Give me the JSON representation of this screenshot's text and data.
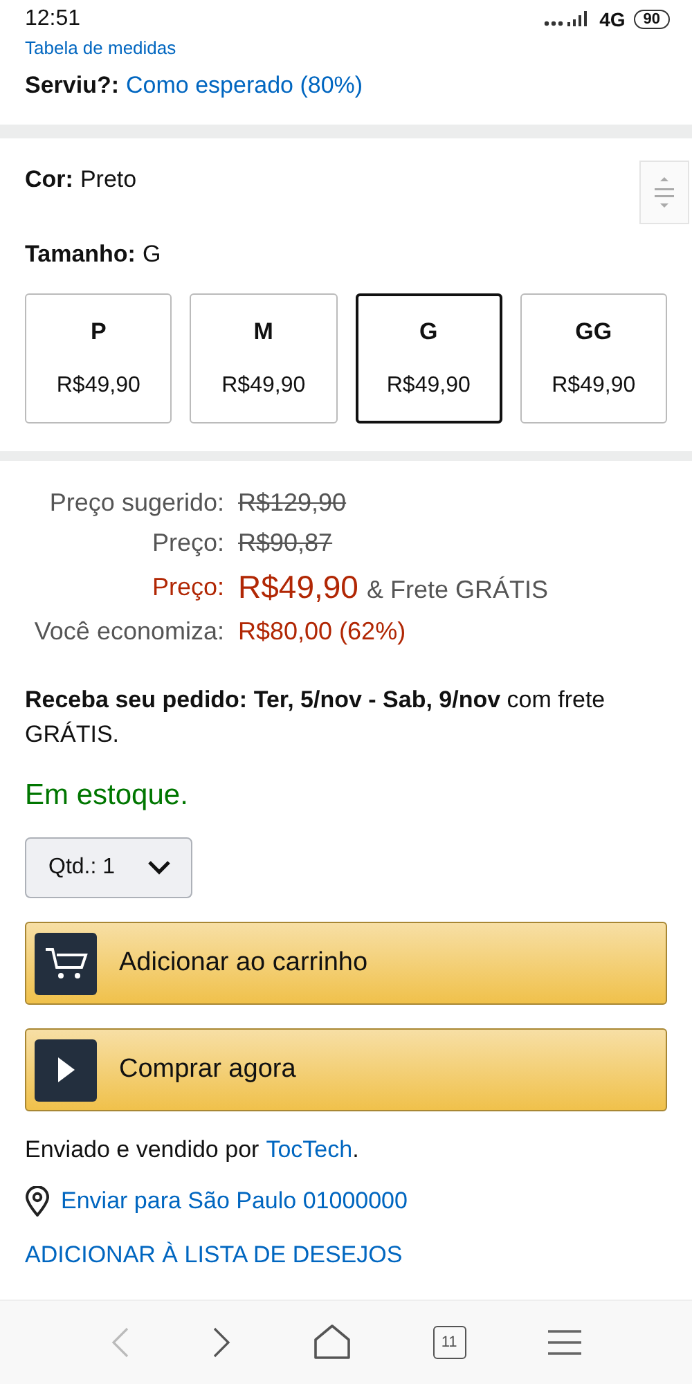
{
  "status_bar": {
    "time": "12:51",
    "network": "4G",
    "battery": "90"
  },
  "size_chart_link": "Tabela de medidas",
  "fit": {
    "label": "Serviu?:",
    "value": "Como esperado (80%)"
  },
  "color": {
    "label": "Cor:",
    "value": "Preto"
  },
  "size": {
    "label": "Tamanho:",
    "value": "G"
  },
  "sizes": [
    {
      "name": "P",
      "price": "R$49,90",
      "selected": false
    },
    {
      "name": "M",
      "price": "R$49,90",
      "selected": false
    },
    {
      "name": "G",
      "price": "R$49,90",
      "selected": true
    },
    {
      "name": "GG",
      "price": "R$49,90",
      "selected": false
    }
  ],
  "prices": [
    {
      "kind": "old",
      "label": "Preço sugerido:",
      "value": "R$129,90"
    },
    {
      "kind": "old",
      "label": "Preço:",
      "value": "R$90,87"
    },
    {
      "kind": "current",
      "label": "Preço:",
      "value": "R$49,90",
      "note": "& Frete GRÁTIS"
    },
    {
      "kind": "saving",
      "label": "Você economiza:",
      "value": "R$80,00 (62%)"
    }
  ],
  "delivery": "**Receba seu pedido: Ter, 5/nov - Sab, 9/nov** com frete GRÁTIS.",
  "stock": "Em estoque.",
  "quantity": {
    "label": "Qtd.:",
    "value": "1"
  },
  "buttons": [
    {
      "kind": "cart",
      "label": "Adicionar ao carrinho"
    },
    {
      "kind": "buy",
      "label": "Comprar agora"
    }
  ],
  "seller": {
    "text": "Enviado e vendido por",
    "link": "TocTech",
    "end": "."
  },
  "ship_to": "Enviar para São Paulo 01000000",
  "wishlist": "ADICIONAR À LISTA DE DESEJOS",
  "nav": {
    "back_disabled": true,
    "tabs_count": "11"
  }
}
